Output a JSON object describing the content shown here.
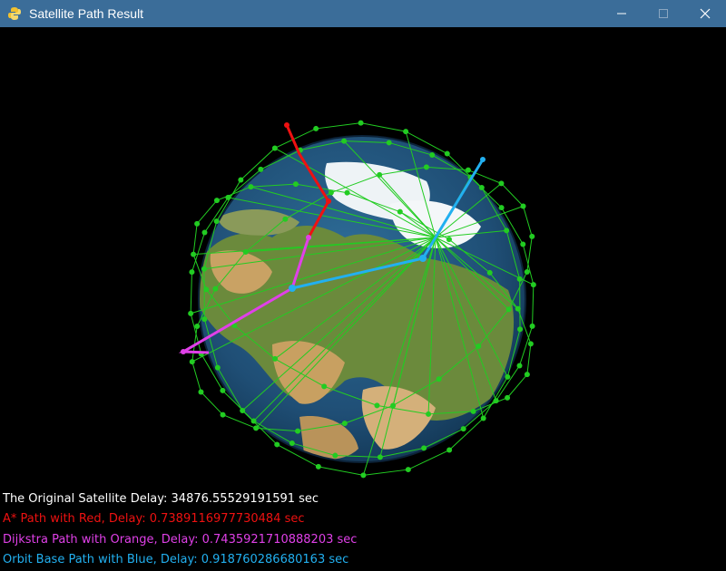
{
  "window": {
    "title": "Satellite Path Result",
    "controls": [
      "minimize",
      "maximize",
      "close"
    ]
  },
  "colors": {
    "titlebar": "#3b6d99",
    "constellation": "#22cc22",
    "astar": "#ee1111",
    "dijkstra": "#e040e8",
    "orbit": "#22b0f0",
    "original": "#ffffff"
  },
  "results": [
    {
      "text": "The Original Satellite Delay: 34876.55529191591 sec",
      "color": "#ffffff"
    },
    {
      "text": "A* Path with Red, Delay: 0.7389116977730484 sec",
      "color": "#ee1111"
    },
    {
      "text": "Dijkstra Path with Orange, Delay: 0.7435921710888203 sec",
      "color": "#e040e8"
    },
    {
      "text": "Orbit Base Path with Blue, Delay: 0.918760286680163 sec",
      "color": "#22b0f0"
    }
  ]
}
